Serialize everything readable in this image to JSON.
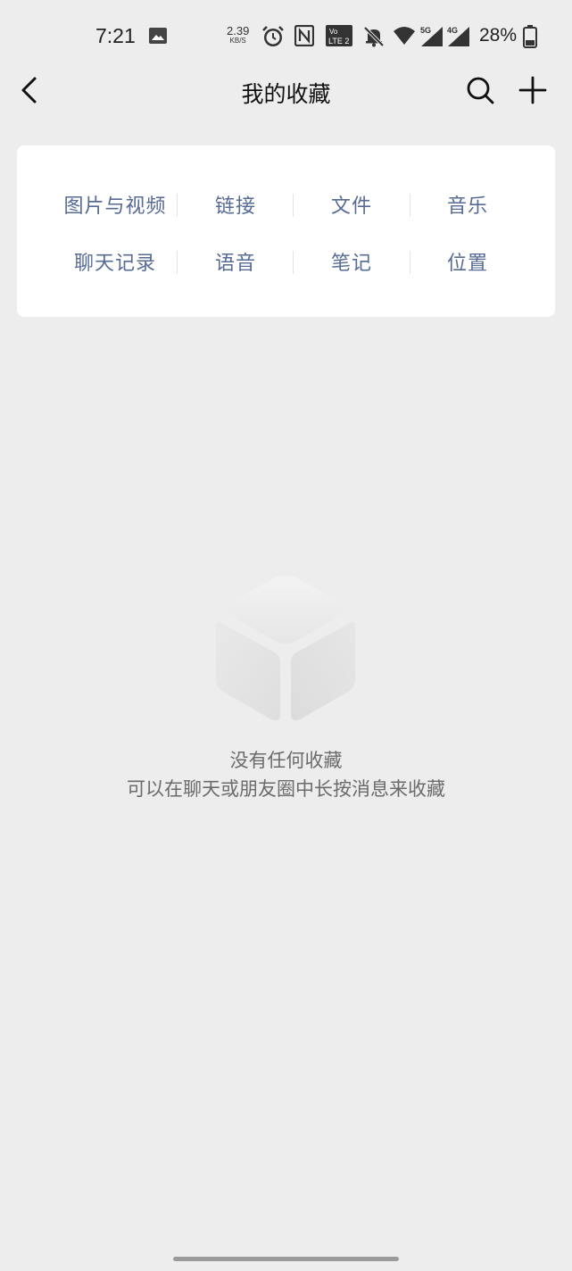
{
  "status_bar": {
    "time": "7:21",
    "net_speed_value": "2.39",
    "net_speed_unit": "KB/S",
    "battery_percent": "28%",
    "icons": [
      "gallery-icon",
      "alarm-icon",
      "nfc-icon",
      "volte-icon",
      "mute-icon",
      "wifi-icon",
      "signal-5g-icon",
      "signal-4g-icon",
      "battery-icon"
    ],
    "volte_label": "Vo LTE 2",
    "signal_5g_label": "5G",
    "signal_4g_label": "4G"
  },
  "nav": {
    "title": "我的收藏",
    "back_icon": "back-arrow-icon",
    "search_icon": "search-icon",
    "add_icon": "plus-icon"
  },
  "categories": {
    "row1": [
      "图片与视频",
      "链接",
      "文件",
      "音乐"
    ],
    "row2": [
      "聊天记录",
      "语音",
      "笔记",
      "位置"
    ],
    "text_color": "#576b95"
  },
  "empty_state": {
    "icon": "empty-box-icon",
    "title": "没有任何收藏",
    "hint": "可以在聊天或朋友圈中长按消息来收藏"
  },
  "colors": {
    "background": "#ededed",
    "card": "#ffffff",
    "link": "#576b95",
    "muted_text": "#6b6b6b"
  }
}
